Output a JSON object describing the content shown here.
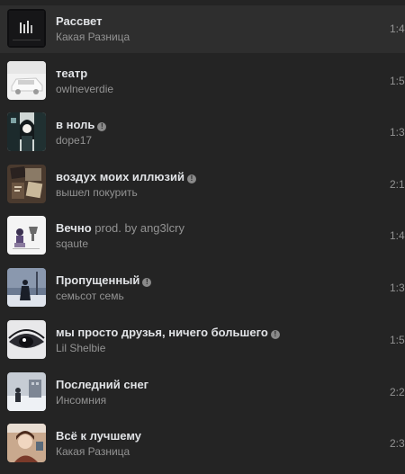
{
  "tracks": [
    {
      "title": "Рассвет",
      "subtitle": "",
      "artist": "Какая Разница",
      "duration": "1:4",
      "explicit": false,
      "active": true,
      "cover_icon": "dark-piano-cover-icon"
    },
    {
      "title": "театр",
      "subtitle": "",
      "artist": "owlneverdie",
      "duration": "1:5",
      "explicit": false,
      "active": false,
      "cover_icon": "white-car-cover-icon"
    },
    {
      "title": "в ноль",
      "subtitle": "",
      "artist": "dope17",
      "duration": "1:3",
      "explicit": true,
      "active": false,
      "cover_icon": "anime-girl-cover-icon"
    },
    {
      "title": "воздух моих иллюзий",
      "subtitle": "",
      "artist": "вышел покурить",
      "duration": "2:1",
      "explicit": true,
      "active": false,
      "cover_icon": "collage-cover-icon"
    },
    {
      "title": "Вечно",
      "subtitle": "prod. by ang3lcry",
      "artist": "sqaute",
      "duration": "1:4",
      "explicit": false,
      "active": false,
      "cover_icon": "anime-sketch-cover-icon"
    },
    {
      "title": "Пропущенный",
      "subtitle": "",
      "artist": "семьсот семь",
      "duration": "1:3",
      "explicit": true,
      "active": false,
      "cover_icon": "winter-silhouette-cover-icon"
    },
    {
      "title": "мы просто друзья, ничего большего",
      "subtitle": "",
      "artist": "Lil Shelbie",
      "duration": "1:5",
      "explicit": true,
      "active": false,
      "cover_icon": "eye-closeup-cover-icon"
    },
    {
      "title": "Последний снег",
      "subtitle": "",
      "artist": "Инсомния",
      "duration": "2:2",
      "explicit": false,
      "active": false,
      "cover_icon": "snow-scene-cover-icon"
    },
    {
      "title": "Всё к лучшему",
      "subtitle": "",
      "artist": "Какая Разница",
      "duration": "2:3",
      "explicit": false,
      "active": false,
      "cover_icon": "portrait-cover-icon"
    }
  ],
  "explicit_glyph": "!",
  "colors": {
    "background": "#242424",
    "active_row": "#2e2e2e",
    "title": "#e1e3e6",
    "secondary": "#939393"
  }
}
